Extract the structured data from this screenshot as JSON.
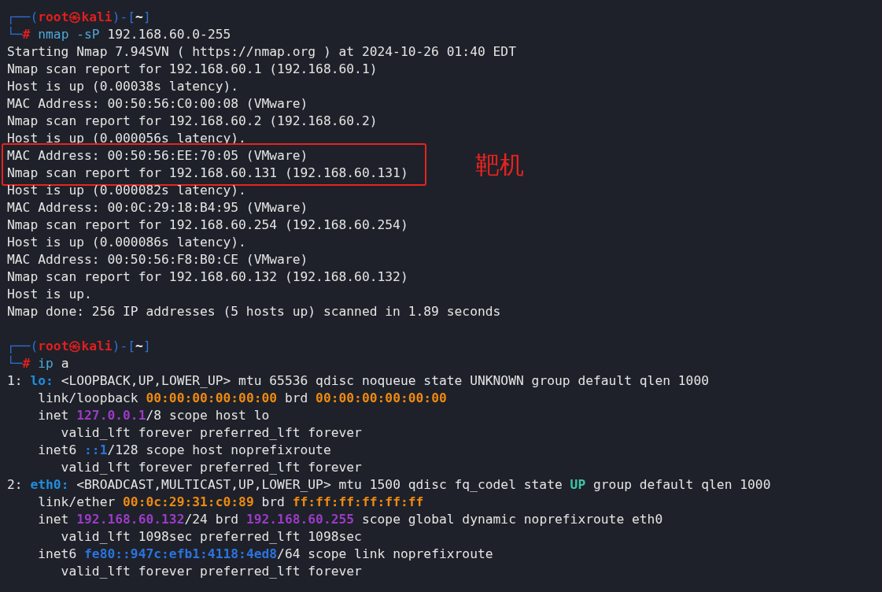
{
  "sessions": [
    {
      "lines": [
        {
          "highlighted": false,
          "segments": [
            {
              "kind": "frame",
              "text": "┌──("
            },
            {
              "kind": "user",
              "text": "root㉿kali"
            },
            {
              "kind": "frame",
              "text": ")-["
            },
            {
              "kind": "dir",
              "text": "~"
            },
            {
              "kind": "frame",
              "text": "]"
            }
          ]
        },
        {
          "highlighted": false,
          "segments": [
            {
              "kind": "frame",
              "text": "└─"
            },
            {
              "kind": "user",
              "text": "#"
            },
            {
              "kind": "cmd",
              "text": " nmap -sP"
            },
            {
              "kind": "plain",
              "text": " 192.168.60.0-255"
            }
          ]
        },
        {
          "highlighted": false,
          "segments": [
            {
              "kind": "plain",
              "text": "Starting Nmap 7.94SVN ( https://nmap.org ) at 2024-10-26 01:40 EDT"
            }
          ]
        },
        {
          "highlighted": false,
          "segments": [
            {
              "kind": "plain",
              "text": "Nmap scan report for 192.168.60.1 (192.168.60.1)"
            }
          ]
        },
        {
          "highlighted": false,
          "segments": [
            {
              "kind": "plain",
              "text": "Host is up (0.00038s latency)."
            }
          ]
        },
        {
          "highlighted": false,
          "segments": [
            {
              "kind": "plain",
              "text": "MAC Address: 00:50:56:C0:00:08 (VMware)"
            }
          ]
        },
        {
          "highlighted": false,
          "segments": [
            {
              "kind": "plain",
              "text": "Nmap scan report for 192.168.60.2 (192.168.60.2)"
            }
          ]
        },
        {
          "highlighted": false,
          "segments": [
            {
              "kind": "plain",
              "text": "Host is up (0.000056s latency)."
            }
          ]
        },
        {
          "highlighted": true,
          "segments": [
            {
              "kind": "plain",
              "text": "MAC Address: 00:50:56:EE:70:05 (VMware)"
            }
          ]
        },
        {
          "highlighted": true,
          "segments": [
            {
              "kind": "plain",
              "text": "Nmap scan report for 192.168.60.131 (192.168.60.131)"
            }
          ]
        },
        {
          "highlighted": false,
          "segments": [
            {
              "kind": "plain",
              "text": "Host is up (0.000082s latency)."
            }
          ]
        },
        {
          "highlighted": false,
          "segments": [
            {
              "kind": "plain",
              "text": "MAC Address: 00:0C:29:18:B4:95 (VMware)"
            }
          ]
        },
        {
          "highlighted": false,
          "segments": [
            {
              "kind": "plain",
              "text": "Nmap scan report for 192.168.60.254 (192.168.60.254)"
            }
          ]
        },
        {
          "highlighted": false,
          "segments": [
            {
              "kind": "plain",
              "text": "Host is up (0.000086s latency)."
            }
          ]
        },
        {
          "highlighted": false,
          "segments": [
            {
              "kind": "plain",
              "text": "MAC Address: 00:50:56:F8:B0:CE (VMware)"
            }
          ]
        },
        {
          "highlighted": false,
          "segments": [
            {
              "kind": "plain",
              "text": "Nmap scan report for 192.168.60.132 (192.168.60.132)"
            }
          ]
        },
        {
          "highlighted": false,
          "segments": [
            {
              "kind": "plain",
              "text": "Host is up."
            }
          ]
        },
        {
          "highlighted": false,
          "segments": [
            {
              "kind": "plain",
              "text": "Nmap done: 256 IP addresses (5 hosts up) scanned in 1.89 seconds"
            }
          ]
        }
      ]
    },
    {
      "lines": [
        {
          "highlighted": false,
          "segments": [
            {
              "kind": "frame",
              "text": "┌──("
            },
            {
              "kind": "user",
              "text": "root㉿kali"
            },
            {
              "kind": "frame",
              "text": ")-["
            },
            {
              "kind": "dir",
              "text": "~"
            },
            {
              "kind": "frame",
              "text": "]"
            }
          ]
        },
        {
          "highlighted": false,
          "segments": [
            {
              "kind": "frame",
              "text": "└─"
            },
            {
              "kind": "user",
              "text": "#"
            },
            {
              "kind": "cmd",
              "text": " ip"
            },
            {
              "kind": "plain",
              "text": " a"
            }
          ]
        },
        {
          "highlighted": false,
          "segments": [
            {
              "kind": "plain",
              "text": "1: "
            },
            {
              "kind": "iface",
              "text": "lo:"
            },
            {
              "kind": "plain",
              "text": " <LOOPBACK,UP,LOWER_UP> mtu 65536 qdisc noqueue state UNKNOWN group default qlen 1000"
            }
          ]
        },
        {
          "highlighted": false,
          "segments": [
            {
              "kind": "plain",
              "text": "    link/loopback "
            },
            {
              "kind": "mac",
              "text": "00:00:00:00:00:00"
            },
            {
              "kind": "plain",
              "text": " brd "
            },
            {
              "kind": "mac",
              "text": "00:00:00:00:00:00"
            }
          ]
        },
        {
          "highlighted": false,
          "segments": [
            {
              "kind": "plain",
              "text": "    inet "
            },
            {
              "kind": "ip4",
              "text": "127.0.0.1"
            },
            {
              "kind": "plain",
              "text": "/8 scope host lo"
            }
          ]
        },
        {
          "highlighted": false,
          "segments": [
            {
              "kind": "plain",
              "text": "       valid_lft forever preferred_lft forever"
            }
          ]
        },
        {
          "highlighted": false,
          "segments": [
            {
              "kind": "plain",
              "text": "    inet6 "
            },
            {
              "kind": "ip6",
              "text": "::1"
            },
            {
              "kind": "plain",
              "text": "/128 scope host noprefixroute"
            }
          ]
        },
        {
          "highlighted": false,
          "segments": [
            {
              "kind": "plain",
              "text": "       valid_lft forever preferred_lft forever"
            }
          ]
        },
        {
          "highlighted": false,
          "segments": [
            {
              "kind": "plain",
              "text": "2: "
            },
            {
              "kind": "iface",
              "text": "eth0:"
            },
            {
              "kind": "plain",
              "text": " <BROADCAST,MULTICAST,UP,LOWER_UP> mtu 1500 qdisc fq_codel state "
            },
            {
              "kind": "state",
              "text": "UP"
            },
            {
              "kind": "plain",
              "text": " group default qlen 1000"
            }
          ]
        },
        {
          "highlighted": false,
          "segments": [
            {
              "kind": "plain",
              "text": "    link/ether "
            },
            {
              "kind": "mac",
              "text": "00:0c:29:31:c0:89"
            },
            {
              "kind": "plain",
              "text": " brd "
            },
            {
              "kind": "mac",
              "text": "ff:ff:ff:ff:ff:ff"
            }
          ]
        },
        {
          "highlighted": false,
          "segments": [
            {
              "kind": "plain",
              "text": "    inet "
            },
            {
              "kind": "ip4",
              "text": "192.168.60.132"
            },
            {
              "kind": "plain",
              "text": "/24 brd "
            },
            {
              "kind": "ip4",
              "text": "192.168.60.255"
            },
            {
              "kind": "plain",
              "text": " scope global dynamic noprefixroute eth0"
            }
          ]
        },
        {
          "highlighted": false,
          "segments": [
            {
              "kind": "plain",
              "text": "       valid_lft 1098sec preferred_lft 1098sec"
            }
          ]
        },
        {
          "highlighted": false,
          "segments": [
            {
              "kind": "plain",
              "text": "    inet6 "
            },
            {
              "kind": "ip6",
              "text": "fe80::947c:efb1:4118:4ed8"
            },
            {
              "kind": "plain",
              "text": "/64 scope link noprefixroute"
            }
          ]
        },
        {
          "highlighted": false,
          "segments": [
            {
              "kind": "plain",
              "text": "       valid_lft forever preferred_lft forever"
            }
          ]
        }
      ]
    }
  ],
  "annotation": {
    "text": "靶机"
  }
}
